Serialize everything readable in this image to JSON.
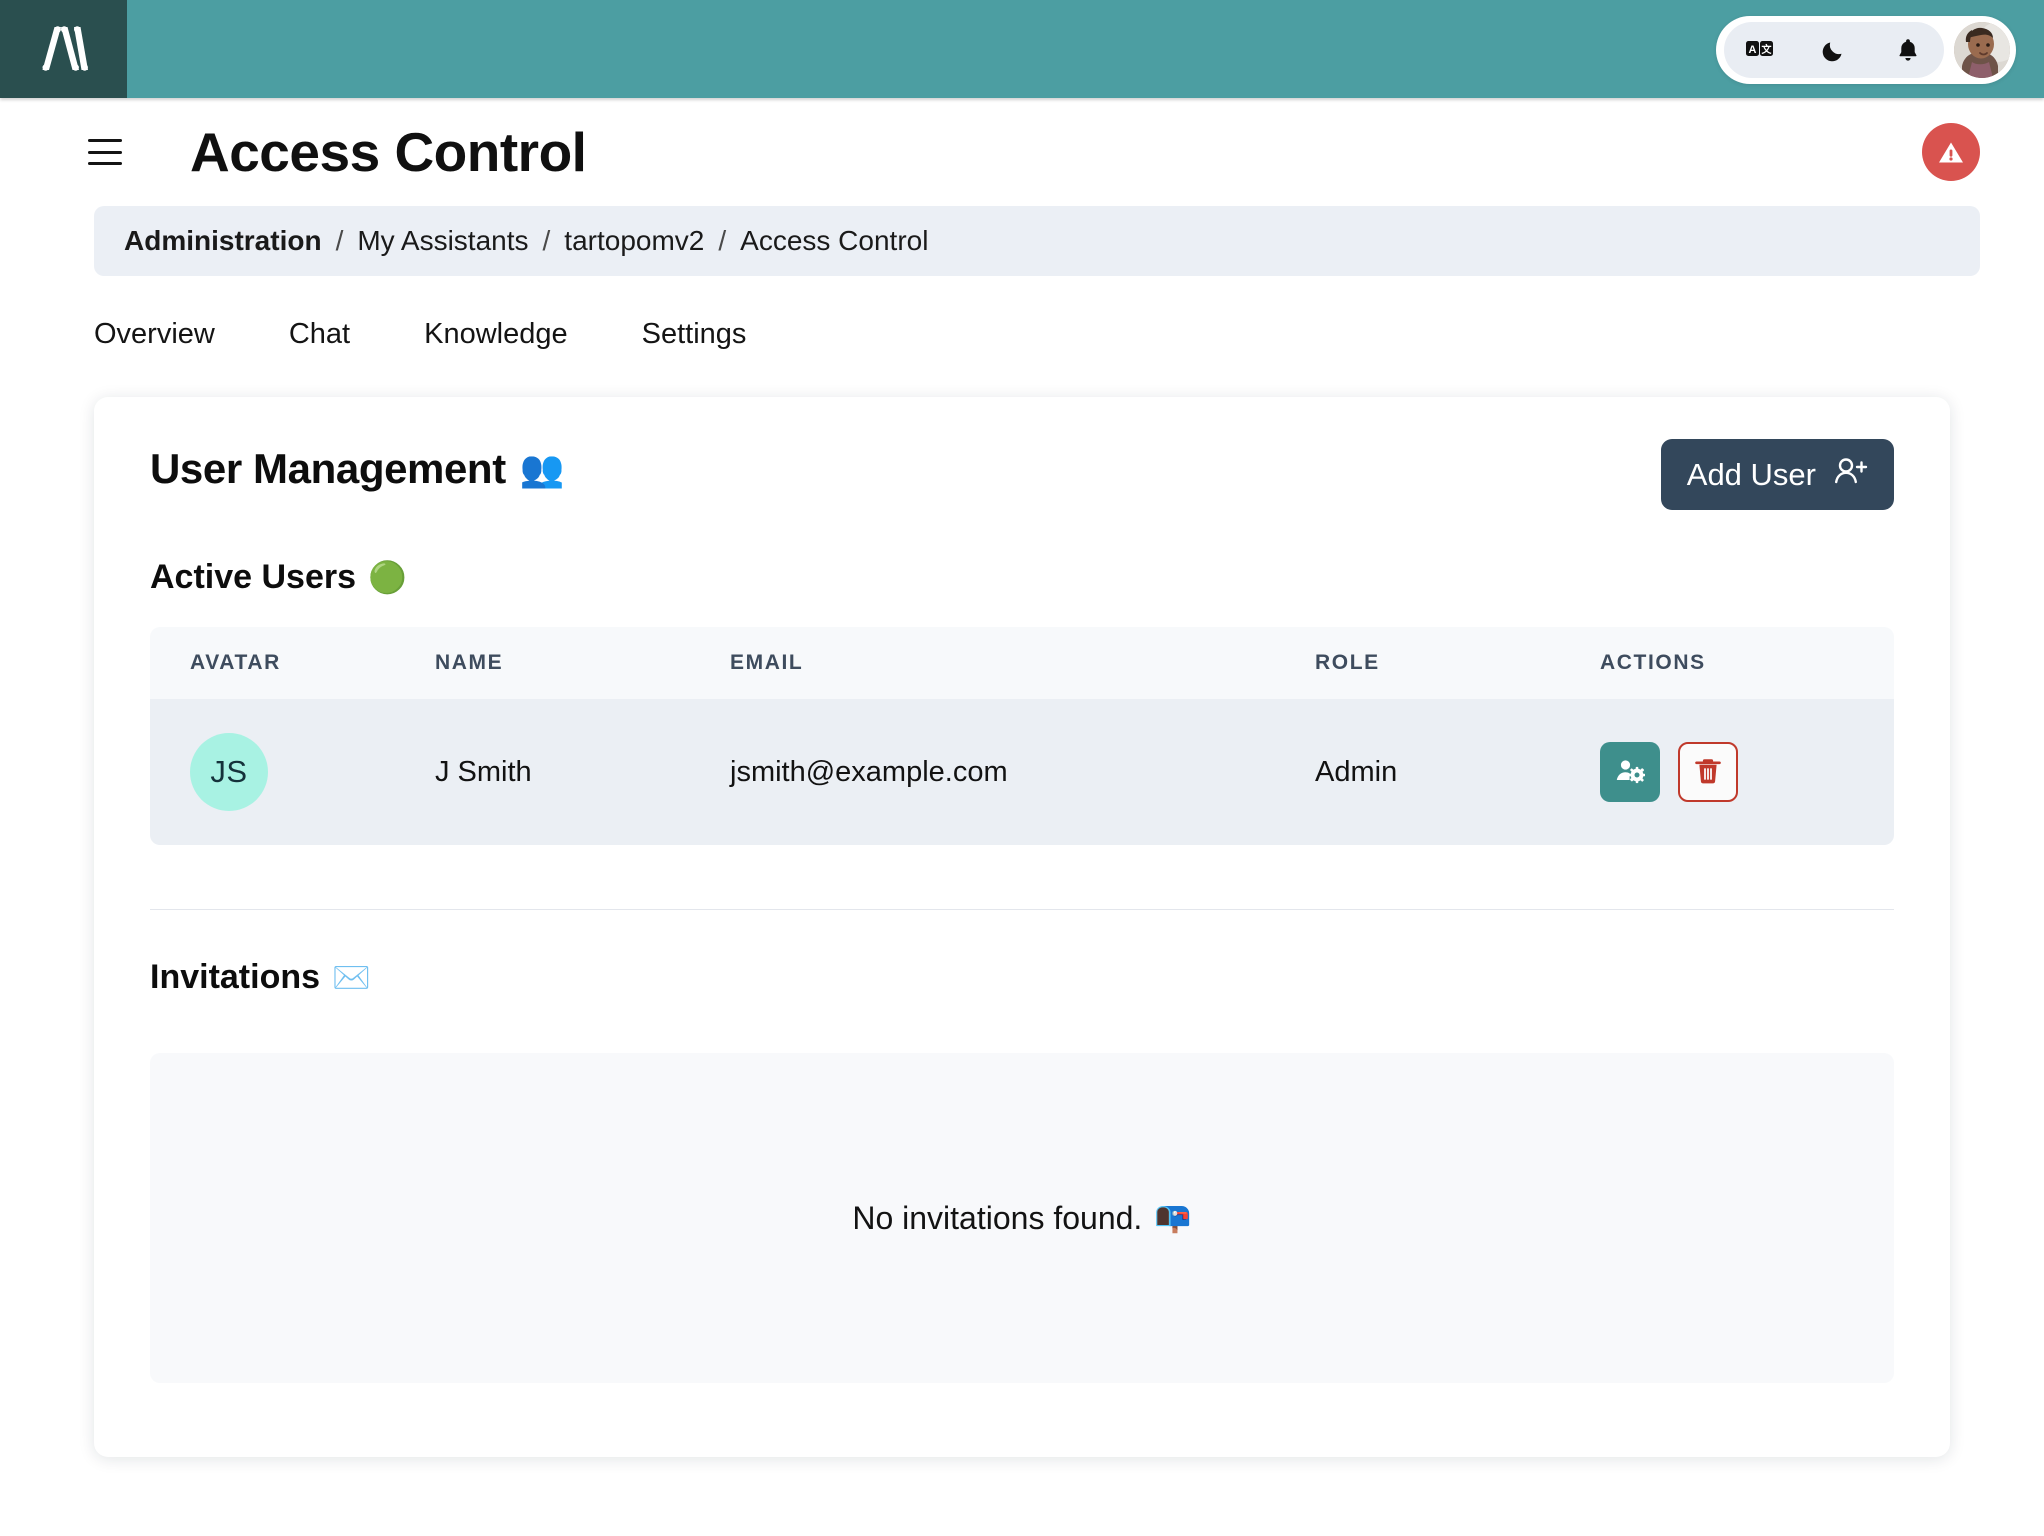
{
  "topbar": {
    "logo_name": "app-logo",
    "icons": [
      {
        "name": "translate-icon",
        "label": "Translate"
      },
      {
        "name": "dark-mode-icon",
        "label": "Dark mode"
      },
      {
        "name": "notifications-bell-icon",
        "label": "Notifications"
      }
    ],
    "avatar_label": "User profile",
    "bar_color": "#4C9EA2",
    "logo_tile_color": "#2A4F4F"
  },
  "header": {
    "menu_label": "Menu",
    "title": "Access Control",
    "alert_label": "Alert",
    "alert_color": "#D9534F"
  },
  "breadcrumb": {
    "items": [
      {
        "label": "Administration"
      },
      {
        "label": "My Assistants"
      },
      {
        "label": "tartopomv2"
      },
      {
        "label": "Access Control"
      }
    ],
    "separator": "/"
  },
  "tabs": [
    {
      "label": "Overview"
    },
    {
      "label": "Chat"
    },
    {
      "label": "Knowledge"
    },
    {
      "label": "Settings"
    }
  ],
  "main": {
    "section_title": "User Management",
    "section_emoji": "👥",
    "add_user_label": "Add User",
    "active_users_title": "Active Users",
    "active_users_emoji": "🟢",
    "table": {
      "columns": [
        "AVATAR",
        "NAME",
        "EMAIL",
        "ROLE",
        "ACTIONS"
      ],
      "rows": [
        {
          "initials": "JS",
          "name": "J Smith",
          "email": "jsmith@example.com",
          "role": "Admin",
          "avatar_color": "#A8F2E3",
          "manage_label": "Manage user",
          "delete_label": "Delete user"
        }
      ]
    },
    "invitations_title": "Invitations",
    "invitations_emoji": "✉️",
    "invitations_empty": "No invitations found.",
    "invitations_empty_emoji": "📭"
  }
}
